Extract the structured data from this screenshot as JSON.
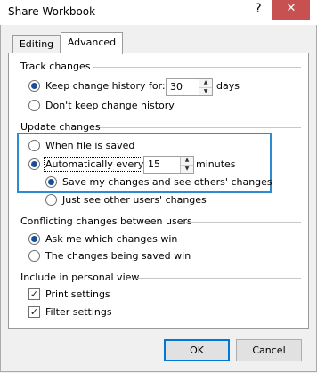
{
  "window": {
    "title": "Share Workbook",
    "help_glyph": "?",
    "close_glyph": "✕"
  },
  "tabs": [
    {
      "label": "Editing",
      "selected": false
    },
    {
      "label": "Advanced",
      "selected": true
    }
  ],
  "track_changes": {
    "heading": "Track changes",
    "keep_history": {
      "label": "Keep change history for:",
      "value": "30",
      "unit": "days",
      "selected": true
    },
    "dont_keep": {
      "label": "Don't keep change history",
      "selected": false
    }
  },
  "update_changes": {
    "heading": "Update changes",
    "when_saved": {
      "label": "When file is saved",
      "selected": false
    },
    "automatically": {
      "label": "Automatically every:",
      "value": "15",
      "unit": "minutes",
      "selected": true
    },
    "save_and_see": {
      "label": "Save my changes and see others' changes",
      "selected": true
    },
    "just_see": {
      "label": "Just see other users' changes",
      "selected": false
    }
  },
  "conflicting": {
    "heading": "Conflicting changes between users",
    "ask_me": {
      "label": "Ask me which changes win",
      "selected": true
    },
    "being_saved": {
      "label": "The changes being saved win",
      "selected": false
    }
  },
  "personal_view": {
    "heading": "Include in personal view",
    "print_settings": {
      "label": "Print settings",
      "checked": true
    },
    "filter_settings": {
      "label": "Filter settings",
      "checked": true
    }
  },
  "buttons": {
    "ok": "OK",
    "cancel": "Cancel"
  },
  "colors": {
    "highlight_border": "#2e8bcf",
    "close_button": "#c75050"
  }
}
